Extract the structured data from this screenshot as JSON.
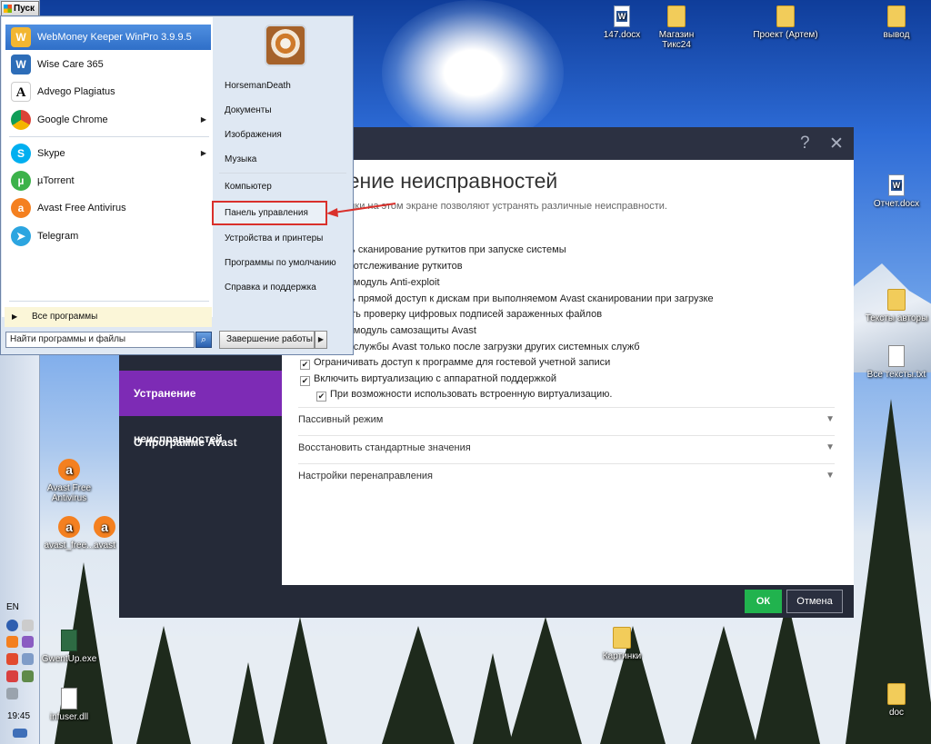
{
  "taskbar": {
    "start_label": "Пуск",
    "language": "EN",
    "clock": "19:45"
  },
  "desktop": {
    "icons": [
      {
        "name": "147-docx",
        "label": "147.docx",
        "icon": "word-doc-icon"
      },
      {
        "name": "magazin-tiks24",
        "label": "Магазин Тикс24",
        "icon": "folder-icon"
      },
      {
        "name": "proekt-artem",
        "label": "Проект (Артем)",
        "icon": "folder-icon"
      },
      {
        "name": "vyvod",
        "label": "вывод",
        "icon": "folder-icon"
      },
      {
        "name": "otchet-docx",
        "label": "Отчет.docx",
        "icon": "word-doc-icon"
      },
      {
        "name": "teksty-avtory",
        "label": "Тексты авторы",
        "icon": "folder-icon"
      },
      {
        "name": "vse-teksty",
        "label": "Все тексты.txt",
        "icon": "text-file-icon"
      },
      {
        "name": "avast-free-antivirus",
        "label": "Avast Free Antivirus",
        "icon": "avast-icon"
      },
      {
        "name": "avast-free-exe",
        "label": "avast_free...",
        "icon": "avast-icon"
      },
      {
        "name": "avast-2",
        "label": "avast",
        "icon": "avast-icon"
      },
      {
        "name": "gwentup",
        "label": "GwentUp.exe",
        "icon": "app-icon"
      },
      {
        "name": "infuser-dll",
        "label": "infuser.dll",
        "icon": "file-icon"
      },
      {
        "name": "kartinki",
        "label": "Картинки",
        "icon": "folder-icon"
      },
      {
        "name": "doc-folder",
        "label": "doc",
        "icon": "folder-icon"
      }
    ]
  },
  "start_menu": {
    "programs": [
      {
        "label": "WebMoney Keeper WinPro 3.9.9.5",
        "icon": "webmoney-icon",
        "color": "#3a7ad0",
        "selected": true,
        "submenu": false
      },
      {
        "label": "Wise Care 365",
        "icon": "wise-care-icon",
        "color": "#2d6db8",
        "selected": false,
        "submenu": false
      },
      {
        "label": "Advego Plagiatus",
        "icon": "advego-icon",
        "color": "#222222",
        "selected": false,
        "submenu": false
      },
      {
        "label": "Google Chrome",
        "icon": "chrome-icon",
        "color": "#db4437",
        "selected": false,
        "submenu": true
      },
      {
        "label": "Skype",
        "icon": "skype-icon",
        "color": "#00aff0",
        "selected": false,
        "submenu": true
      },
      {
        "label": "µTorrent",
        "icon": "utorrent-icon",
        "color": "#3cb24a",
        "selected": false,
        "submenu": false
      },
      {
        "label": "Avast Free Antivirus",
        "icon": "avast-icon",
        "color": "#f48020",
        "selected": false,
        "submenu": false
      },
      {
        "label": "Telegram",
        "icon": "telegram-icon",
        "color": "#2ca5e0",
        "selected": false,
        "submenu": false
      }
    ],
    "all_programs": "Все программы",
    "search_placeholder": "Найти программы и файлы",
    "right_items": [
      "HorsemanDeath",
      "Документы",
      "Изображения",
      "Музыка",
      "Компьютер",
      "Панель управления",
      "Устройства и принтеры",
      "Программы по умолчанию",
      "Справка и поддержка"
    ],
    "shutdown_label": "Завершение работы",
    "highlight_color": "#d9302b"
  },
  "avast": {
    "heading": "нение неисправностей",
    "description": "ройки на этом экране позволяют устранять различные неисправности.",
    "options": [
      {
        "label": "ть сканирование руткитов при запуске системы",
        "checked": null
      },
      {
        "label": "ь отслеживание руткитов",
        "checked": null
      },
      {
        "label": "ь модуль Anti-exploit",
        "checked": null
      },
      {
        "label": "ть прямой доступ к дискам при выполняемом Avast сканировании при загрузке",
        "checked": null
      },
      {
        "label": "ить проверку цифровых подписей зараженных файлов",
        "checked": null
      },
      {
        "label": "ь модуль самозащиты Avast",
        "checked": null
      },
      {
        "label": "ь службы Avast только после загрузки других системных служб",
        "checked": null
      },
      {
        "label": "Ограничивать доступ к программе для гостевой учетной записи",
        "checked": true
      },
      {
        "label": "Включить виртуализацию с аппаратной поддержкой",
        "checked": true
      },
      {
        "label": "При возможности использовать встроенную виртуализацию.",
        "checked": true,
        "indent": true
      }
    ],
    "sections": [
      "Пассивный режим",
      "Восстановить стандартные значения",
      "Настройки перенаправления"
    ],
    "nav": {
      "active": "Устранение неисправностей",
      "about": "О программе Avast"
    },
    "help_icon": "?",
    "close_icon": "✕",
    "ok_label": "ОК",
    "cancel_label": "Отмена",
    "accent_purple": "#7d2bb5",
    "accent_green": "#21b34e"
  }
}
